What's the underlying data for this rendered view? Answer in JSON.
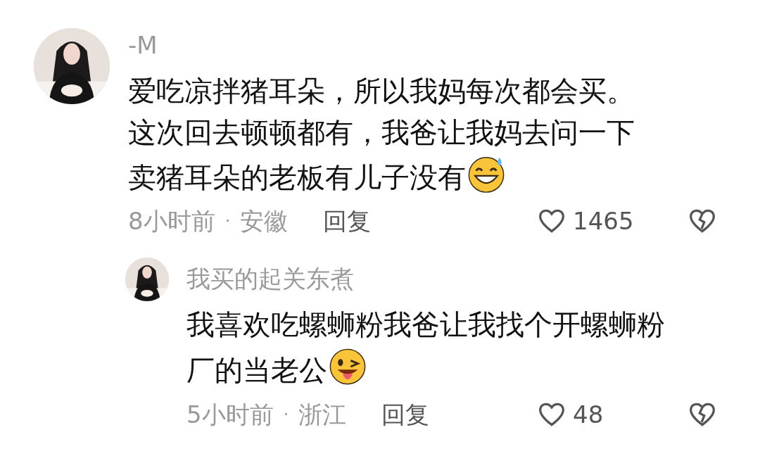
{
  "comments": [
    {
      "user": "-M",
      "lines": [
        "爱吃凉拌猪耳朵，所以我妈每次都会买。",
        "这次回去顿顿都有，我爸让我妈去问一下",
        "卖猪耳朵的老板有儿子没有"
      ],
      "emoji": {
        "kind": "sweat-grin"
      },
      "time": "8小时前",
      "sep": "·",
      "location": "安徽",
      "reply": "回复",
      "likes": "1465",
      "kind": "top"
    },
    {
      "user": "我买的起关东煮",
      "lines": [
        "我喜欢吃螺蛳粉我爸让我找个开螺蛳粉",
        "厂的当老公"
      ],
      "emoji": {
        "kind": "wink-tongue"
      },
      "time": "5小时前",
      "sep": "·",
      "location": "浙江",
      "reply": "回复",
      "likes": "48",
      "kind": "reply"
    }
  ]
}
